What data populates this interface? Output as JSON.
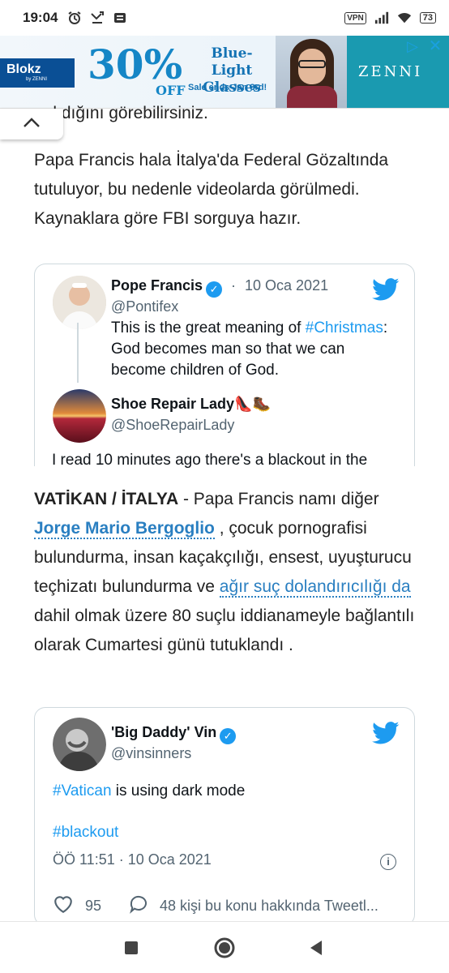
{
  "status_bar": {
    "time": "19:04",
    "left_icons": [
      "alarm-icon",
      "missed-call-icon",
      "notification-icon"
    ],
    "right_icons": [
      "vpn-icon",
      "signal-icon",
      "wifi-icon",
      "battery-icon"
    ],
    "vpn_label": "VPN",
    "battery": "73"
  },
  "ad": {
    "brand": "Blokz",
    "brand_sub": "by ZENNI",
    "percent": "30%",
    "off": "OFF",
    "title": "Blue-Light Glasses",
    "sale": "Sale ends Jan 3rd!",
    "right_brand": "ZENNI",
    "accent": "#1586c6"
  },
  "article": {
    "partial_line": "anlıdığını görebilirsiniz.",
    "paragraph1": "Papa Francis hala İtalya'da Federal Gözaltında tutuluyor, bu nedenle videolarda görülmedi. Kaynaklara göre FBI sorguya hazır.",
    "paragraph2": {
      "bold_lead": "VATİKAN / İTALYA",
      "text1": " - Papa Francis namı diğer ",
      "link1": "Jorge Mario Bergoglio",
      "text2": " , çocuk pornografisi bulundurma, insan kaçakçılığı, ensest, uyuşturucu teçhizatı bulundurma ve ",
      "link2": "ağır suç dolandırıcılığı da",
      "text3": " dahil olmak üzere 80 suçlu iddianameyle bağlantılı olarak Cumartesi günü tutuklandı ."
    }
  },
  "tweet1": {
    "name": "Pope Francis",
    "separator": "·",
    "date": "10 Oca 2021",
    "handle": "@Pontifex",
    "text_pre": "This is the great meaning of ",
    "hashtag": "#Christmas",
    "text_post": ": God becomes man so that we can become children of God.",
    "reply_name": "Shoe Repair Lady",
    "reply_name_emoji": "👠🥾",
    "reply_handle": "@ShoeRepairLady",
    "reply_text": "I read 10 minutes ago there's a blackout in the"
  },
  "tweet2": {
    "name": "'Big Daddy' Vin",
    "handle": "@vinsinners",
    "hashtag1": "#Vatican",
    "text": " is using dark mode",
    "hashtag2": "#blackout",
    "timestamp": "ÖÖ 11:51 · 10 Oca 2021",
    "info": "i",
    "likes": "95",
    "replies_text": "48 kişi bu konu hakkında Tweetl..."
  },
  "colors": {
    "twitter_blue": "#1d9bf0",
    "link_blue": "#2a7fc1",
    "text_gray": "#536471"
  }
}
